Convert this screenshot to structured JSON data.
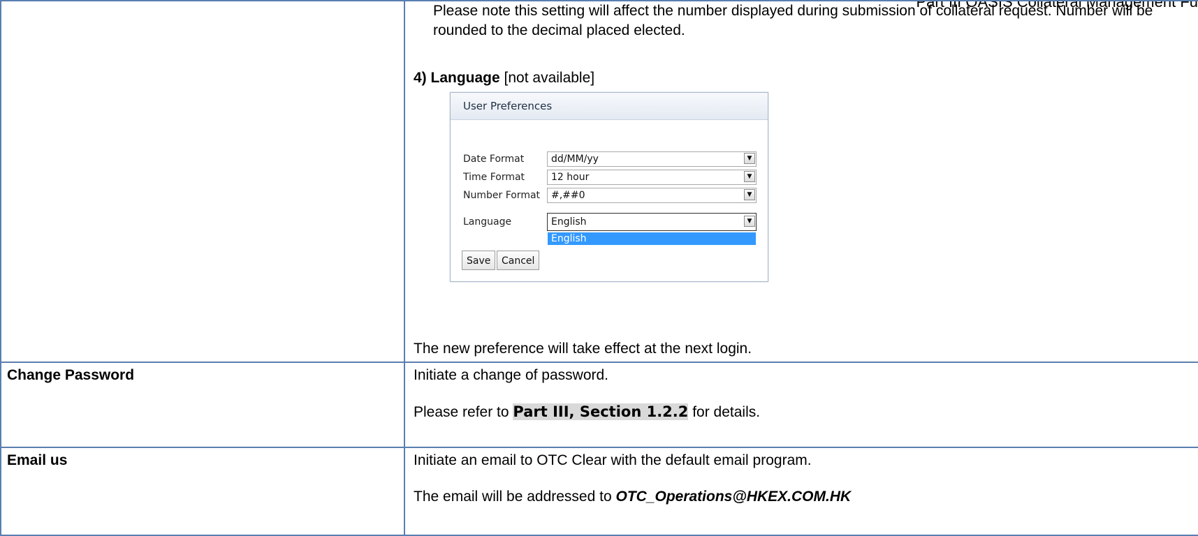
{
  "running_head": "Part III OASIS Collateral Management Fu",
  "row_preferences": {
    "intro_text": "Please note this setting will affect the number displayed during submission of collateral request. Number will be rounded to the decimal placed elected.",
    "language_heading": "4) Language",
    "language_note": " [not available]",
    "dialog": {
      "title": "User Preferences",
      "fields": [
        {
          "label": "Date Format",
          "value": "dd/MM/yy"
        },
        {
          "label": "Time Format",
          "value": "12 hour"
        },
        {
          "label": "Number Format",
          "value": "#,##0"
        },
        {
          "label": "Language",
          "value": "English"
        }
      ],
      "dropdown_option": "English",
      "save_label": "Save",
      "cancel_label": "Cancel",
      "arrow_icon": "dropdown-arrow-icon"
    },
    "footer_text": "The new preference will take effect at the next login."
  },
  "row_change_password": {
    "label": "Change Password",
    "line1": "Initiate a change of password.",
    "refer_prefix": "Please refer to ",
    "refer_link": "Part III, Section 1.2.2",
    "refer_suffix": " for details."
  },
  "row_email": {
    "label": "Email us",
    "line1": "Initiate an email to OTC Clear with the default email program.",
    "line2_prefix": "The email will be addressed to ",
    "email": "OTC_Operations@HKEX.COM.HK"
  }
}
